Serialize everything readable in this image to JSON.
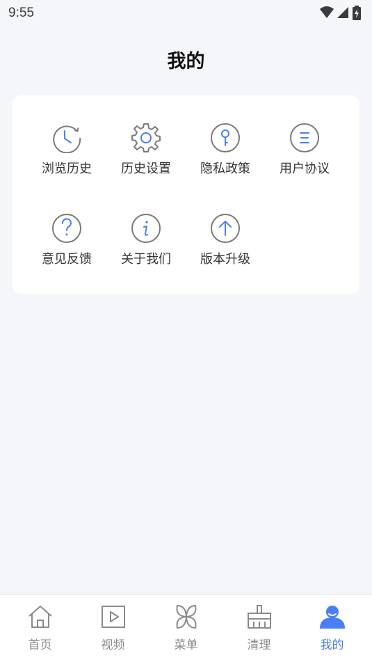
{
  "status": {
    "time": "9:55",
    "icons": [
      "wifi-icon",
      "signal-icon",
      "battery-charging-icon"
    ]
  },
  "page": {
    "title": "我的"
  },
  "colors": {
    "accent": "#4a7ef4",
    "icon_gray": "#7a7a7a",
    "background": "#f5f6fa",
    "card": "#ffffff"
  },
  "menu": {
    "items": [
      {
        "label": "浏览历史",
        "icon": "history-clock-icon"
      },
      {
        "label": "历史设置",
        "icon": "settings-gear-icon"
      },
      {
        "label": "隐私政策",
        "icon": "privacy-key-icon"
      },
      {
        "label": "用户协议",
        "icon": "agreement-list-icon"
      },
      {
        "label": "意见反馈",
        "icon": "feedback-question-icon"
      },
      {
        "label": "关于我们",
        "icon": "about-info-icon"
      },
      {
        "label": "版本升级",
        "icon": "upgrade-arrow-icon"
      }
    ]
  },
  "tabbar": {
    "tabs": [
      {
        "label": "首页",
        "icon": "home-icon",
        "active": false
      },
      {
        "label": "视频",
        "icon": "video-play-icon",
        "active": false
      },
      {
        "label": "菜单",
        "icon": "menu-petal-icon",
        "active": false
      },
      {
        "label": "清理",
        "icon": "broom-clean-icon",
        "active": false
      },
      {
        "label": "我的",
        "icon": "user-profile-icon",
        "active": true
      }
    ]
  }
}
